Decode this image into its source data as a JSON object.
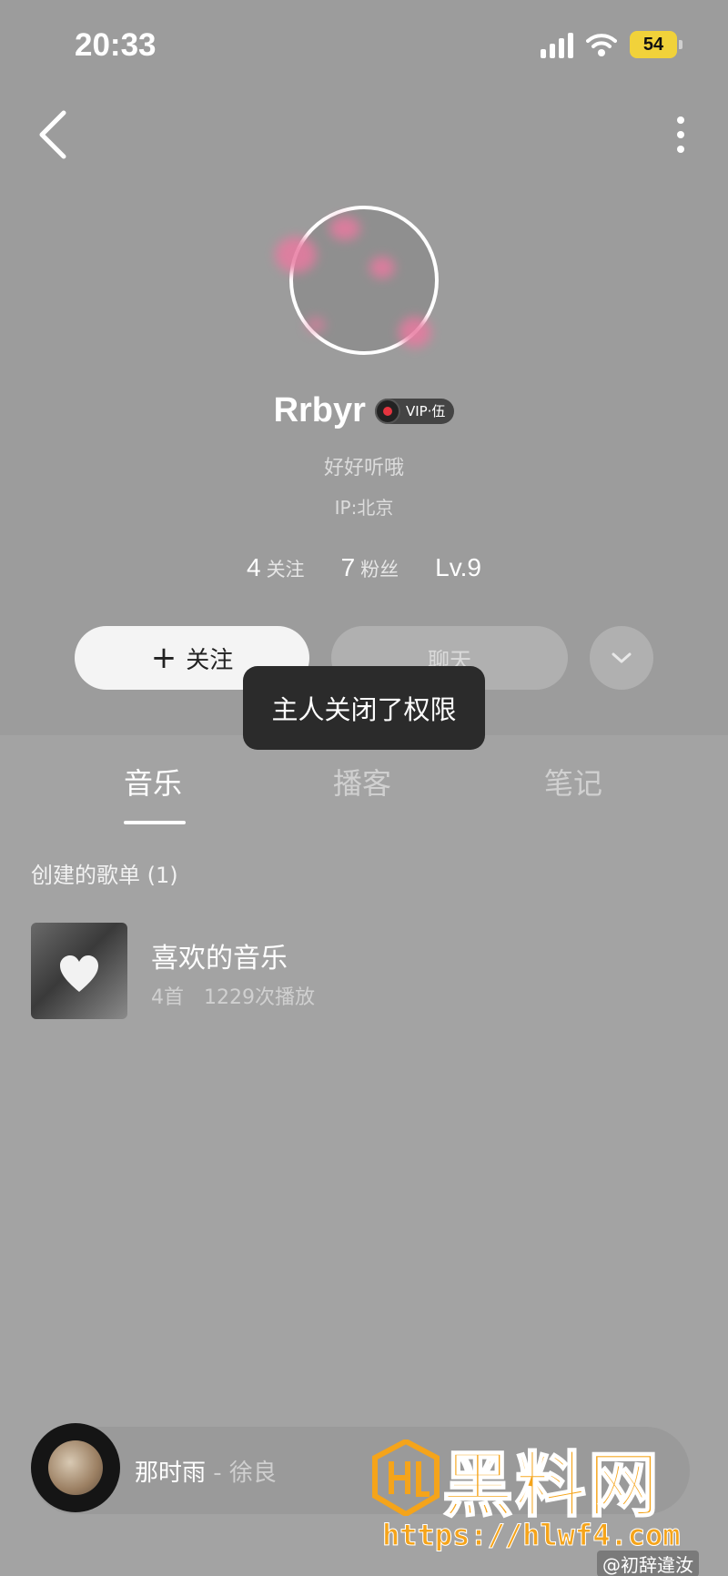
{
  "status_bar": {
    "time": "20:33",
    "battery": "54"
  },
  "profile": {
    "username": "Rrbyr",
    "vip_label": "VIP·伍",
    "signature": "好好听哦",
    "ip_location": "IP:北京",
    "stats": [
      {
        "num": "4",
        "label": "关注"
      },
      {
        "num": "7",
        "label": "粉丝"
      },
      {
        "num": "Lv.9",
        "label": ""
      }
    ]
  },
  "actions": {
    "follow_plus": "+",
    "follow_label": "关注",
    "chat_label": "聊天"
  },
  "toast": "主人关闭了权限",
  "tabs": [
    "音乐",
    "播客",
    "笔记"
  ],
  "section_title": "创建的歌单 (1)",
  "playlist": {
    "name": "喜欢的音乐",
    "count": "4首",
    "plays": "1229次播放"
  },
  "mini_player": {
    "title": "那时雨",
    "artist": " - 徐良"
  },
  "watermark": {
    "title": "黑料网",
    "url": "https://hlwf4.com",
    "handle": "@初辞違汝"
  },
  "colors": {
    "toast_bg": "#2b2b2b",
    "vip_red": "#e5343f",
    "watermark_orange": "#f5a41a"
  },
  "icons": [
    "back-arrow-icon",
    "more-vertical-icon",
    "chevron-down-icon",
    "heart-icon",
    "vinyl-icon"
  ]
}
